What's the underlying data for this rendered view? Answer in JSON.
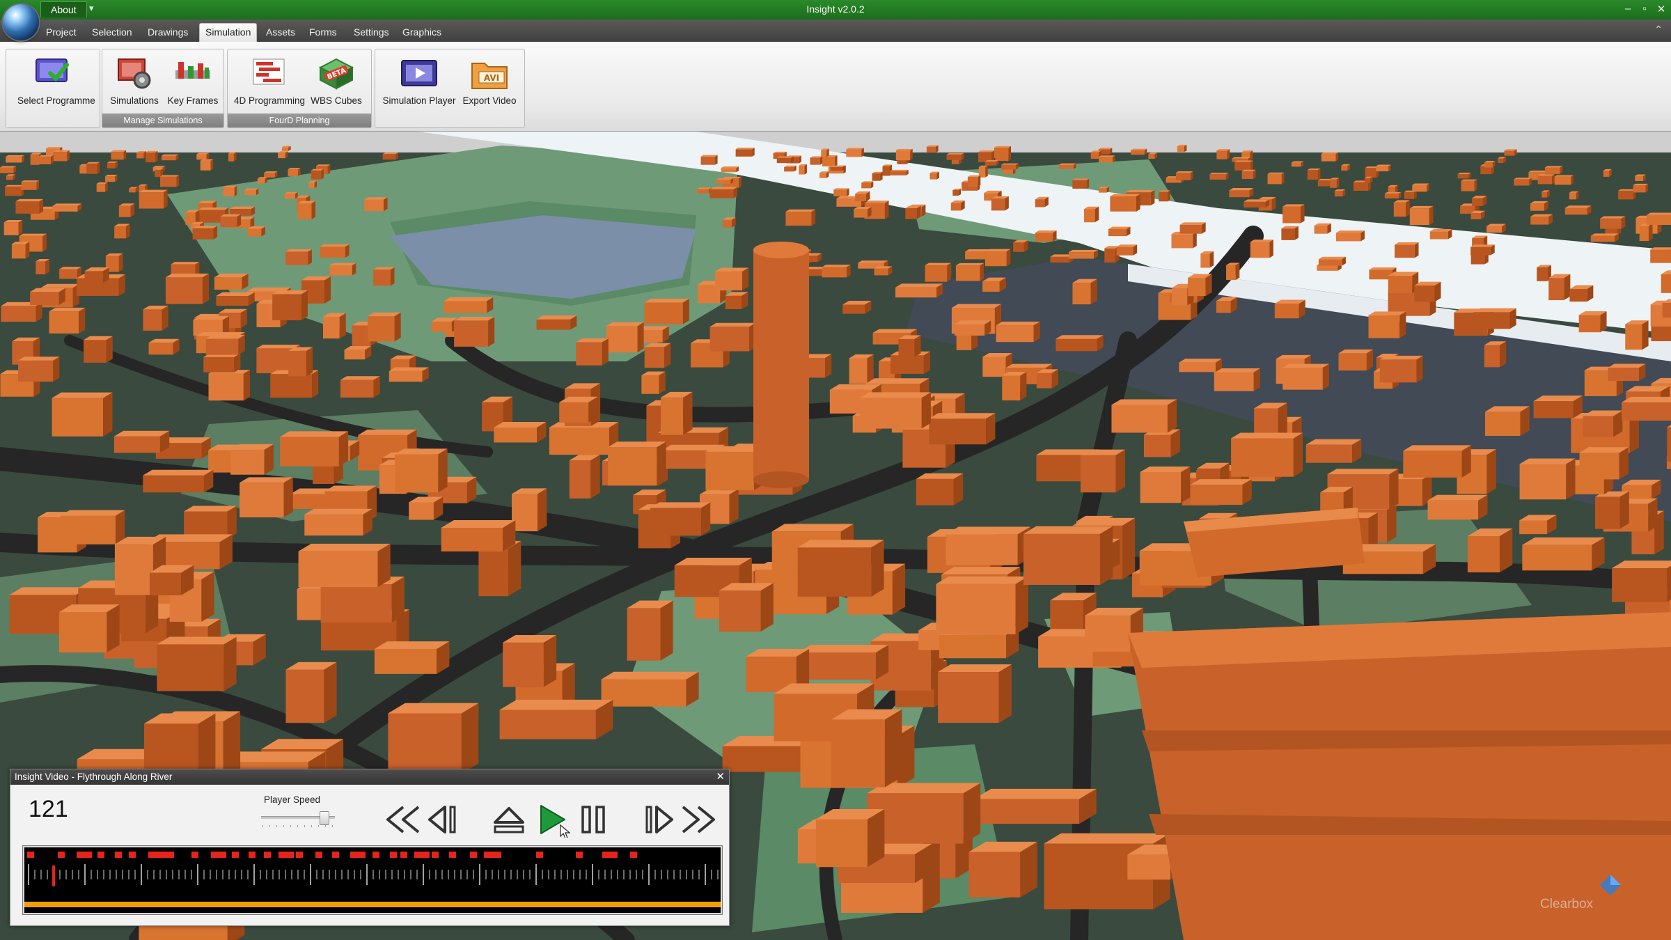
{
  "window": {
    "title": "Insight v2.0.2",
    "about_label": "About",
    "quick_access_icon": "dropdown-arrow-icon",
    "controls": [
      "minimize-icon",
      "restore-icon",
      "close-icon"
    ]
  },
  "menu": {
    "items": [
      "Project",
      "Selection",
      "Drawings",
      "Simulation",
      "Assets",
      "Forms",
      "Settings",
      "Graphics"
    ],
    "active": "Simulation"
  },
  "ribbon": {
    "groups": [
      {
        "label": "",
        "buttons": [
          {
            "label": "Select Programme",
            "icon": "select-programme-icon"
          }
        ]
      },
      {
        "label": "Manage Simulations",
        "buttons": [
          {
            "label": "Simulations",
            "icon": "simulations-icon"
          },
          {
            "label": "Key Frames",
            "icon": "key-frames-icon"
          }
        ]
      },
      {
        "label": "FourD Planning",
        "buttons": [
          {
            "label": "4D Programming",
            "icon": "4d-programming-icon"
          },
          {
            "label": "WBS Cubes",
            "icon": "wbs-cubes-icon"
          }
        ]
      },
      {
        "label": "",
        "buttons": [
          {
            "label": "Simulation Player",
            "icon": "simulation-player-icon"
          },
          {
            "label": "Export Video",
            "icon": "export-video-icon",
            "badge": "AVI"
          }
        ]
      }
    ]
  },
  "player": {
    "title": "Insight Video - Flythrough Along River",
    "frame": "121",
    "speed_label": "Player Speed",
    "speed_level": 0.8,
    "buttons": [
      "rewind-to-start-icon",
      "step-back-icon",
      "eject-icon",
      "play-icon",
      "pause-icon",
      "step-forward-icon",
      "fast-forward-icon"
    ],
    "close_icon": "close-icon",
    "timeline_position": 0.04
  },
  "colors": {
    "title_bar": "#1c6e1c",
    "building": "#d26a2c",
    "park": "#6f9a78",
    "road": "#2f2f2f",
    "river": "#7b8fa8",
    "timeline_keyframe": "#e8231c",
    "timeline_progress": "#f0a000"
  },
  "watermark": "Clearbox"
}
